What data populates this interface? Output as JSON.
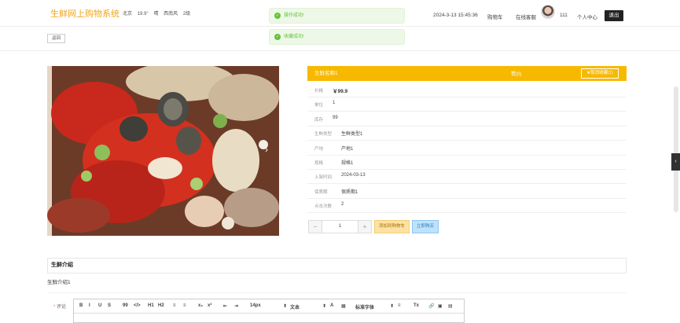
{
  "header": {
    "logo": "生鲜网上购物系统",
    "weather": {
      "city": "北京",
      "temp": "19.9°",
      "condition": "晴",
      "wind": "西南风",
      "level": "2级"
    },
    "datetime": "2024-3-13 15:45:36",
    "cart": "购物车",
    "service": "在线客服",
    "username": "111",
    "user_center": "个人中心",
    "logout": "退出"
  },
  "toasts": {
    "first": "操作成功!",
    "second": "收藏成功!",
    "ok_glyph": "✓"
  },
  "back_button": "返回",
  "gallery": {
    "next_arrow": "›"
  },
  "product": {
    "name": "生鲜名称1",
    "like": "赞(0)",
    "collect": "★取消收藏(1)",
    "fields": [
      {
        "key": "价格",
        "value": "￥99.9"
      },
      {
        "key": "单位",
        "value": "1"
      },
      {
        "key": "库存",
        "value": "99"
      },
      {
        "key": "生鲜类型",
        "value": "生鲜类型1"
      },
      {
        "key": "产地",
        "value": "产地1"
      },
      {
        "key": "规格",
        "value": "规格1"
      },
      {
        "key": "上架时间",
        "value": "2024-03-13"
      },
      {
        "key": "保质期",
        "value": "保质期1"
      },
      {
        "key": "点击次数",
        "value": "2"
      }
    ]
  },
  "purchase": {
    "minus": "−",
    "quantity": "1",
    "plus": "+",
    "add_to_cart": "添加到购物车",
    "buy_now": "立即购买"
  },
  "description": {
    "title": "生鲜介绍",
    "text": "生鲜介绍1"
  },
  "comment": {
    "required_mark": "*",
    "label": "评论",
    "toolbar": [
      "B",
      "I",
      "U",
      "S",
      "99",
      "</>",
      "H1",
      "H2",
      "≡",
      "≡",
      "x₂",
      "x²",
      "⇤",
      "⇥",
      "14px",
      "文本",
      "A",
      "▦",
      "标准字体",
      "≡",
      "Tx",
      "🔗",
      "▣",
      "▤"
    ],
    "dropdown_caret": "⬍"
  },
  "side_handle": "‹"
}
